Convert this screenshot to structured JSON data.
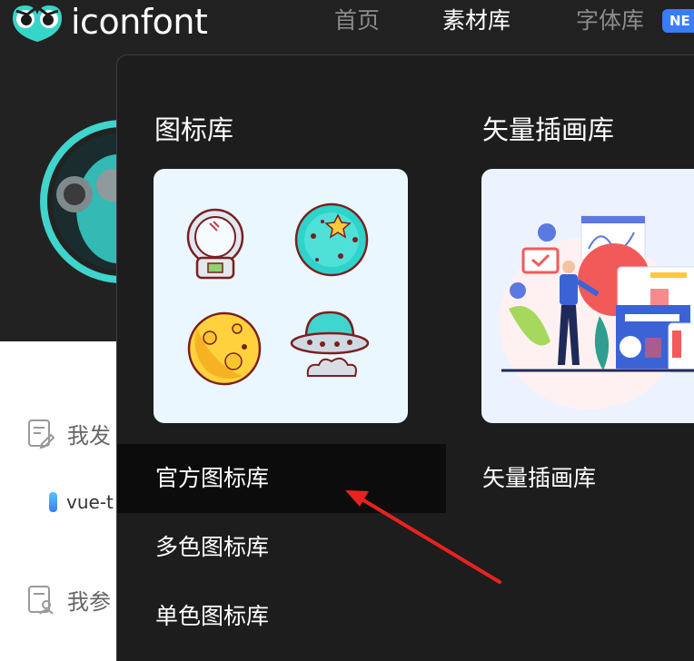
{
  "brand": {
    "name": "iconfont"
  },
  "nav": {
    "home": "首页",
    "material": "素材库",
    "font": "字体库",
    "badge": "NE"
  },
  "dropdown": {
    "icons_title": "图标库",
    "vector_title": "矢量插画库",
    "menu": [
      "官方图标库",
      "多色图标库",
      "单色图标库"
    ],
    "vector_link": "矢量插画库"
  },
  "background": {
    "my_published": "我发",
    "project": "vue-t",
    "my_joined": "我参"
  },
  "colors": {
    "nav_bg": "#212121",
    "dropdown_bg": "#1d1d1d",
    "hover_bg": "#0c0c0c",
    "icons_card_bg": "#eaf7ff",
    "illus_card_bg": "#edf2ff",
    "badge": "#3a7cf6",
    "annotation_arrow": "#e8231f"
  },
  "icons": [
    "astronaut-helmet-icon",
    "planet-star-icon",
    "moon-icon",
    "ufo-icon"
  ]
}
